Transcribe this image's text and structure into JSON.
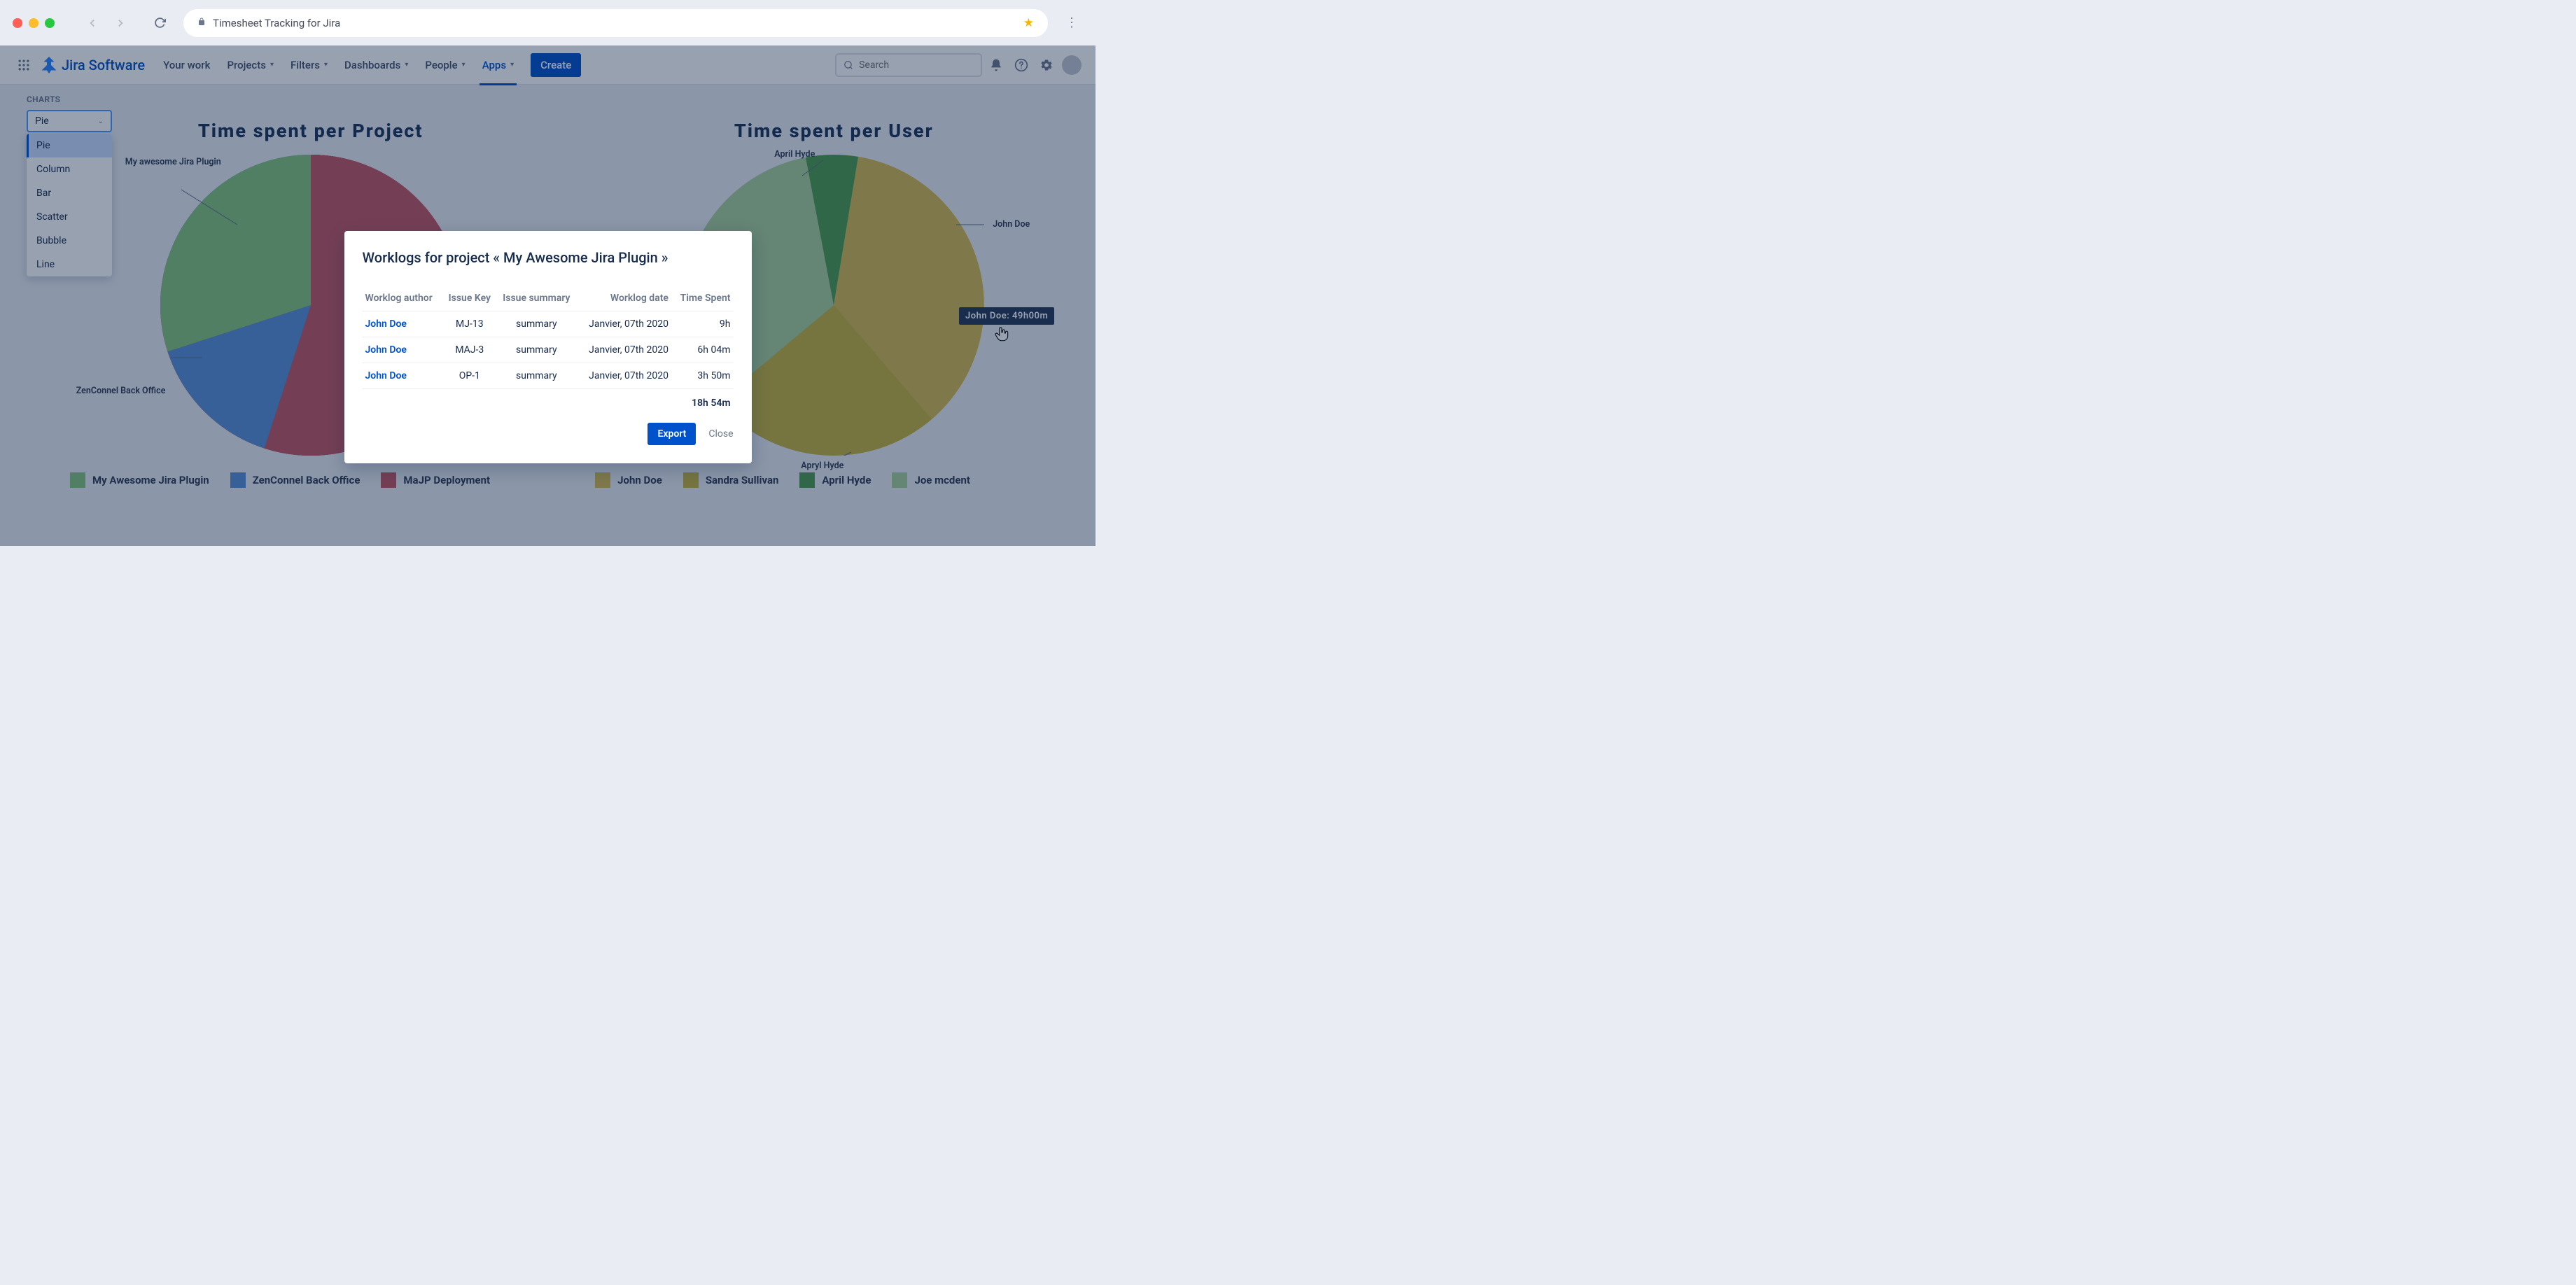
{
  "browser": {
    "page_title": "Timesheet Tracking for Jira"
  },
  "header": {
    "product": "Jira Software",
    "nav": [
      "Your work",
      "Projects",
      "Filters",
      "Dashboards",
      "People",
      "Apps"
    ],
    "active_nav": "Apps",
    "create": "Create",
    "search_placeholder": "Search"
  },
  "sidebar": {
    "label": "CHARTS",
    "selected": "Pie",
    "options": [
      "Pie",
      "Column",
      "Bar",
      "Scatter",
      "Bubble",
      "Line"
    ]
  },
  "charts": {
    "left": {
      "title": "Time spent per Project",
      "labels": {
        "a": "My awesome Jira Plugin",
        "b": "ZenConnel Back Office"
      }
    },
    "right": {
      "title": "Time spent per User",
      "labels": {
        "a": "John Doe",
        "b": "April Hyde",
        "c": "Apryl Hyde"
      }
    }
  },
  "legends": {
    "left": [
      {
        "label": "My Awesome Jira Plugin",
        "color": "#85c47c"
      },
      {
        "label": "ZenConnel Back Office",
        "color": "#5a8fd6"
      },
      {
        "label": "MaJP Deployment",
        "color": "#c25762"
      }
    ],
    "right": [
      {
        "label": "John Doe",
        "color": "#d2b951"
      },
      {
        "label": "Sandra Sullivan",
        "color": "#c5b33e"
      },
      {
        "label": "April Hyde",
        "color": "#4d9b4d"
      },
      {
        "label": "Joe mcdent",
        "color": "#a8cf9a"
      }
    ]
  },
  "tooltip": {
    "text": "John Doe: 49h00m"
  },
  "modal": {
    "title": "Worklogs for project  « My Awesome Jira Plugin »",
    "columns": [
      "Worklog author",
      "Issue Key",
      "Issue summary",
      "Worklog date",
      "Time Spent"
    ],
    "rows": [
      {
        "author": "John Doe",
        "key": "MJ-13",
        "summary": "summary",
        "date": "Janvier, 07th 2020",
        "time": "9h"
      },
      {
        "author": "John Doe",
        "key": "MAJ-3",
        "summary": "summary",
        "date": "Janvier, 07th 2020",
        "time": "6h 04m"
      },
      {
        "author": "John Doe",
        "key": "OP-1",
        "summary": "summary",
        "date": "Janvier, 07th 2020",
        "time": "3h 50m"
      }
    ],
    "total": "18h 54m",
    "export": "Export",
    "close": "Close"
  },
  "chart_data": [
    {
      "type": "pie",
      "title": "Time spent per Project",
      "series": [
        {
          "name": "My awesome Jira Plugin",
          "value": 30,
          "color": "#85c47c"
        },
        {
          "name": "ZenConnel Back Office",
          "value": 15,
          "color": "#5a8fd6"
        },
        {
          "name": "MaJP Deployment",
          "value": 55,
          "color": "#c25762"
        }
      ]
    },
    {
      "type": "pie",
      "title": "Time spent per User",
      "series": [
        {
          "name": "John Doe",
          "value": 49,
          "color": "#d2b951"
        },
        {
          "name": "Sandra Sullivan",
          "value": 30,
          "color": "#c5b33e"
        },
        {
          "name": "April Hyde",
          "value": 8,
          "color": "#4d9b4d"
        },
        {
          "name": "Apryl Hyde",
          "value": 13,
          "color": "#a8cf9a"
        }
      ]
    }
  ]
}
